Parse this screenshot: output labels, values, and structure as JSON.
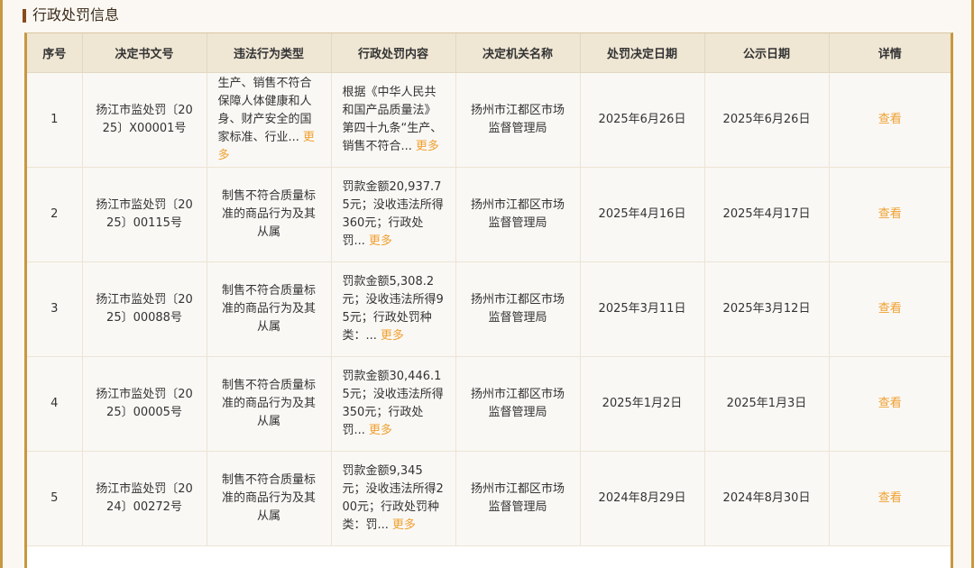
{
  "section": {
    "title": "行政处罚信息"
  },
  "table": {
    "headers": [
      "序号",
      "决定书文号",
      "违法行为类型",
      "行政处罚内容",
      "决定机关名称",
      "处罚决定日期",
      "公示日期",
      "详情"
    ],
    "more_label": "更多",
    "view_label": "查看",
    "rows": [
      {
        "index": "1",
        "doc_no": "扬江市监处罚〔2025〕X00001号",
        "violation": "生产、销售不符合保障人体健康和人身、财产安全的国家标准、行业...",
        "content": "根据《中华人民共和国产品质量法》第四十九条“生产、销售不符合...",
        "authority": "扬州市江都区市场监督管理局",
        "decision_date": "2025年6月26日",
        "publish_date": "2025年6月26日"
      },
      {
        "index": "2",
        "doc_no": "扬江市监处罚〔2025〕00115号",
        "violation": "制售不符合质量标准的商品行为及其从属",
        "content": "罚款金额20,937.75元；没收违法所得360元；行政处罚...",
        "authority": "扬州市江都区市场监督管理局",
        "decision_date": "2025年4月16日",
        "publish_date": "2025年4月17日"
      },
      {
        "index": "3",
        "doc_no": "扬江市监处罚〔2025〕00088号",
        "violation": "制售不符合质量标准的商品行为及其从属",
        "content": "罚款金额5,308.2元；没收违法所得95元；行政处罚种类：...",
        "authority": "扬州市江都区市场监督管理局",
        "decision_date": "2025年3月11日",
        "publish_date": "2025年3月12日"
      },
      {
        "index": "4",
        "doc_no": "扬江市监处罚〔2025〕00005号",
        "violation": "制售不符合质量标准的商品行为及其从属",
        "content": "罚款金额30,446.15元；没收违法所得350元；行政处罚...",
        "authority": "扬州市江都区市场监督管理局",
        "decision_date": "2025年1月2日",
        "publish_date": "2025年1月3日"
      },
      {
        "index": "5",
        "doc_no": "扬江市监处罚〔2024〕00272号",
        "violation": "制售不符合质量标准的商品行为及其从属",
        "content": "罚款金额9,345元；没收违法所得200元；行政处罚种类：罚...",
        "authority": "扬州市江都区市场监督管理局",
        "decision_date": "2024年8月29日",
        "publish_date": "2024年8月30日"
      }
    ]
  }
}
